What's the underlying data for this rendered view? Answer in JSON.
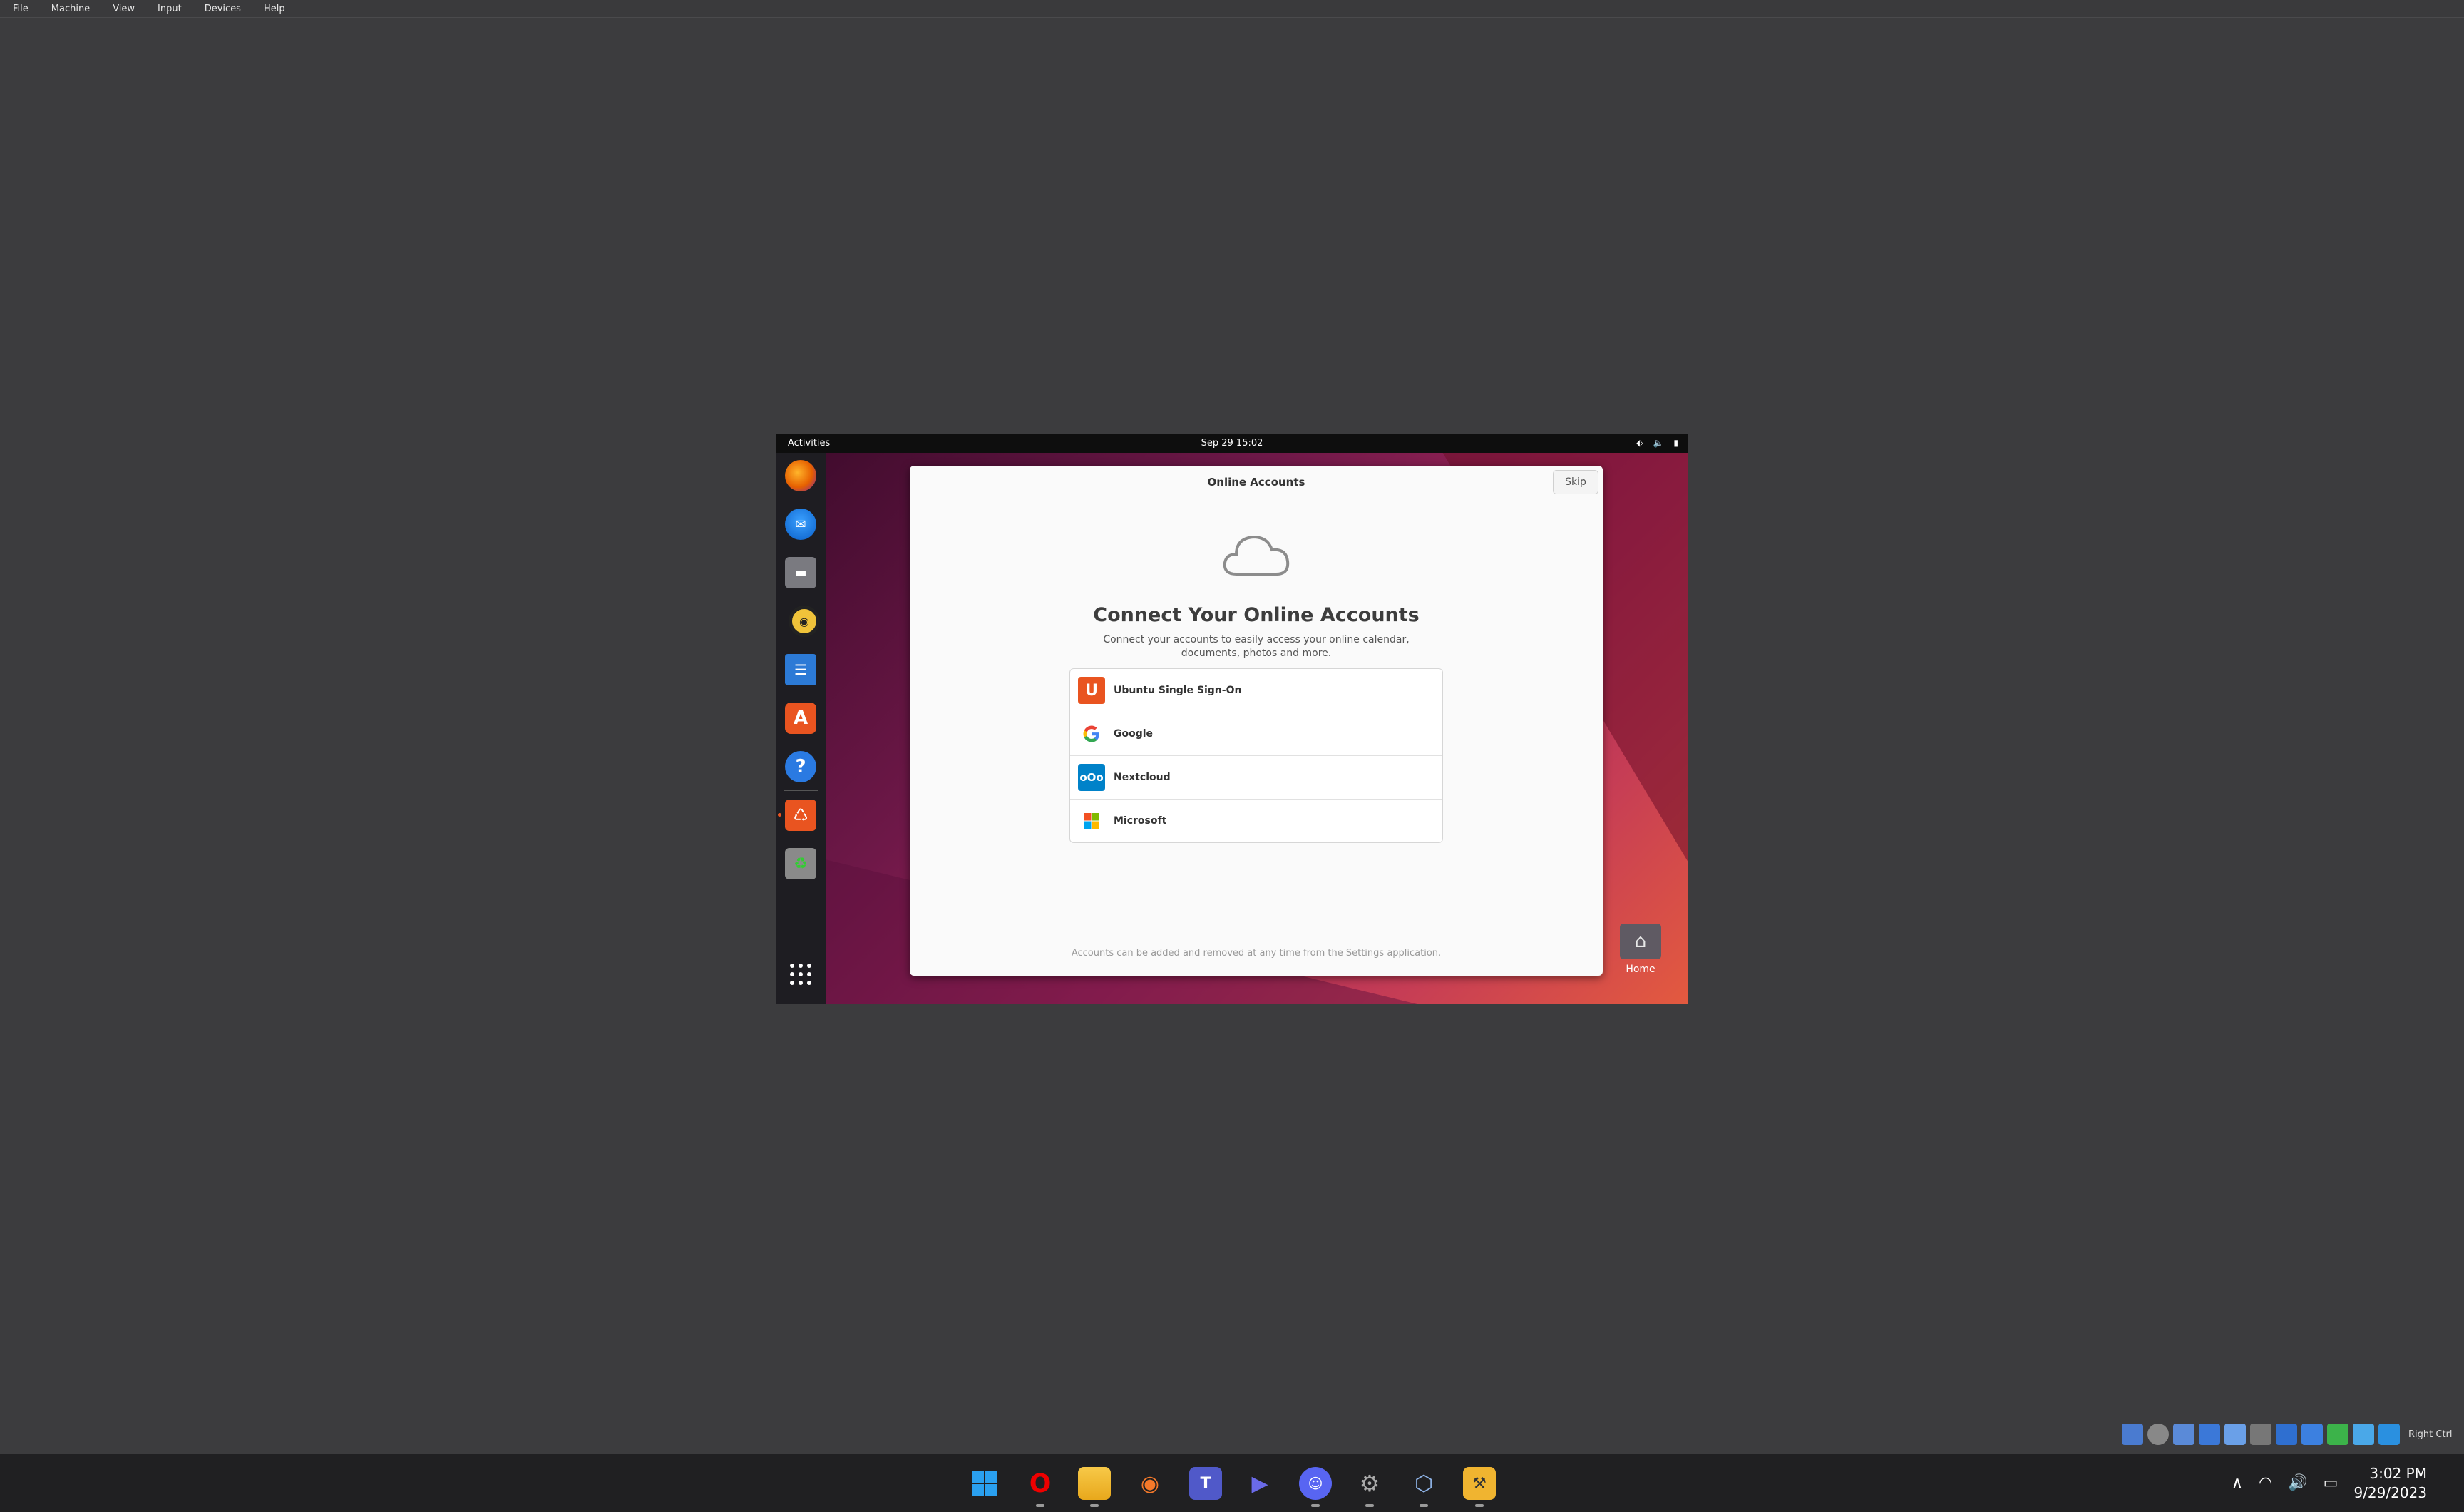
{
  "host_menu": [
    "File",
    "Machine",
    "View",
    "Input",
    "Devices",
    "Help"
  ],
  "vm": {
    "topbar": {
      "activities": "Activities",
      "clock": "Sep 29  15:02"
    },
    "dock_apps": [
      "Firefox",
      "Thunderbird Mail",
      "Files",
      "Rhythmbox",
      "LibreOffice Writer",
      "Ubuntu Software",
      "Help",
      "Ubuntu Installer",
      "Trash",
      "Show Applications"
    ],
    "dialog": {
      "title": "Online Accounts",
      "skip": "Skip",
      "heading": "Connect Your Online Accounts",
      "subtitle": "Connect your accounts to easily access your online calendar, documents, photos and more.",
      "providers": [
        {
          "label": "Ubuntu Single Sign-On",
          "icon": "ubuntu-sso-icon",
          "color": "#e95420"
        },
        {
          "label": "Google",
          "icon": "google-icon",
          "color": "#ffffff"
        },
        {
          "label": "Nextcloud",
          "icon": "nextcloud-icon",
          "color": "#0082c9"
        },
        {
          "label": "Microsoft",
          "icon": "microsoft-icon",
          "color": "#ffffff"
        }
      ],
      "footer": "Accounts can be added and removed at any time from the Settings application."
    },
    "desktop_home_label": "Home"
  },
  "vbox_statusbar": {
    "host_key": "Right Ctrl"
  },
  "taskbar": {
    "apps": [
      "Start",
      "Opera",
      "File Explorer",
      "Blender",
      "Microsoft Teams",
      "Clipchamp",
      "Discord",
      "Settings",
      "VirtualBox",
      "App"
    ],
    "time": "3:02 PM",
    "date": "9/29/2023"
  },
  "colors": {
    "ubuntu_orange": "#e95420",
    "win_blue": "#2aa0f0"
  }
}
